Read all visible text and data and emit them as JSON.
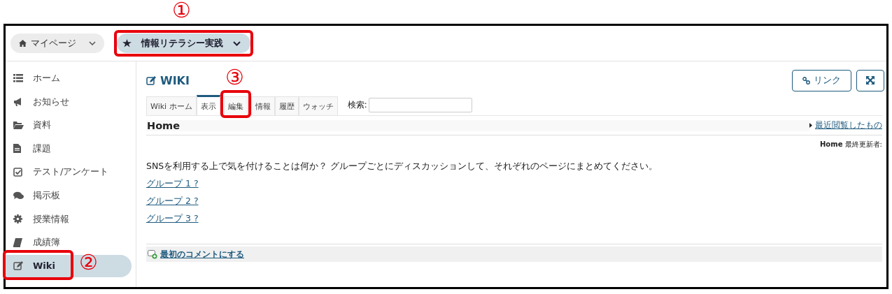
{
  "topbar": {
    "mypage": {
      "label": "マイページ"
    },
    "course": {
      "label": "情報リテラシー実践"
    }
  },
  "sidebar": {
    "items": [
      {
        "label": "ホーム",
        "selected": false
      },
      {
        "label": "お知らせ",
        "selected": false
      },
      {
        "label": "資料",
        "selected": false
      },
      {
        "label": "課題",
        "selected": false
      },
      {
        "label": "テスト/アンケート",
        "selected": false
      },
      {
        "label": "掲示板",
        "selected": false
      },
      {
        "label": "授業情報",
        "selected": false
      },
      {
        "label": "成績簿",
        "selected": false
      },
      {
        "label": "Wiki",
        "selected": true
      }
    ]
  },
  "main": {
    "title": "WIKI",
    "buttons": [
      {
        "kind": "link",
        "label": "リンク"
      },
      {
        "kind": "expand"
      }
    ],
    "tabs": [
      {
        "label": "Wiki ホーム",
        "selected": false
      },
      {
        "label": "表示",
        "selected": true
      },
      {
        "label": "編集",
        "selected": false
      },
      {
        "label": "情報",
        "selected": false
      },
      {
        "label": "履歴",
        "selected": false
      },
      {
        "label": "ウォッチ",
        "selected": false
      }
    ],
    "search": {
      "label": "検索:"
    },
    "page_title": "Home",
    "recent_link": "最近閲覧したもの",
    "last_updated": "**Home** 最終更新者:",
    "body": "SNSを利用する上で気を付けることは何か？ グループごとにディスカッションして、それぞれのページにまとめてください。",
    "links": [
      "グループ 1 ?",
      "グループ 2 ?",
      "グループ 3 ?"
    ],
    "comment_link": "最初のコメントにする"
  },
  "annotations": [
    {
      "label": "①"
    },
    {
      "label": "②"
    },
    {
      "label": "③"
    }
  ]
}
